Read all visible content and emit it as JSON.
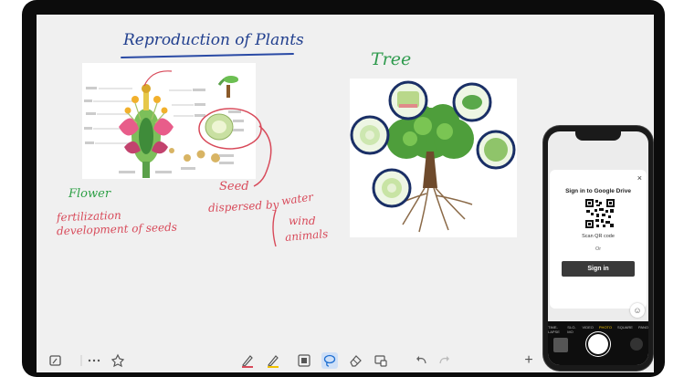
{
  "whiteboard": {
    "title": "Reproduction of Plants",
    "tree_label": "Tree",
    "flower_label": "Flower",
    "flower_notes": [
      "fertilization",
      "development of seeds"
    ],
    "seed_label": "Seed",
    "dispersed_label": "dispersed by",
    "dispersal_agents": [
      "water",
      "wind",
      "animals"
    ]
  },
  "phone": {
    "modal": {
      "close": "×",
      "title": "Sign in to Google Drive",
      "qr_label": "Scan QR code",
      "or_text": "Or",
      "signin_label": "Sign in"
    },
    "camera_modes": [
      "TIME-LAPSE",
      "SLO-MO",
      "VIDEO",
      "PHOTO",
      "SQUARE",
      "PANO"
    ],
    "active_mode": "PHOTO"
  },
  "toolbar": {
    "plus_label": "+",
    "icons": [
      "whiteboard-icon",
      "more-icon",
      "apps-icon",
      "pen-red-icon",
      "pen-yellow-icon",
      "image-icon",
      "lasso-icon",
      "eraser-icon",
      "screen-share-icon",
      "undo-icon",
      "redo-icon",
      "add-icon"
    ]
  },
  "colors": {
    "title": "#213f8e",
    "green": "#2ea046",
    "red": "#d84a5a",
    "bezel": "#0c0c0c",
    "canvas": "#f0f0f0",
    "accent": "#f2c200"
  }
}
